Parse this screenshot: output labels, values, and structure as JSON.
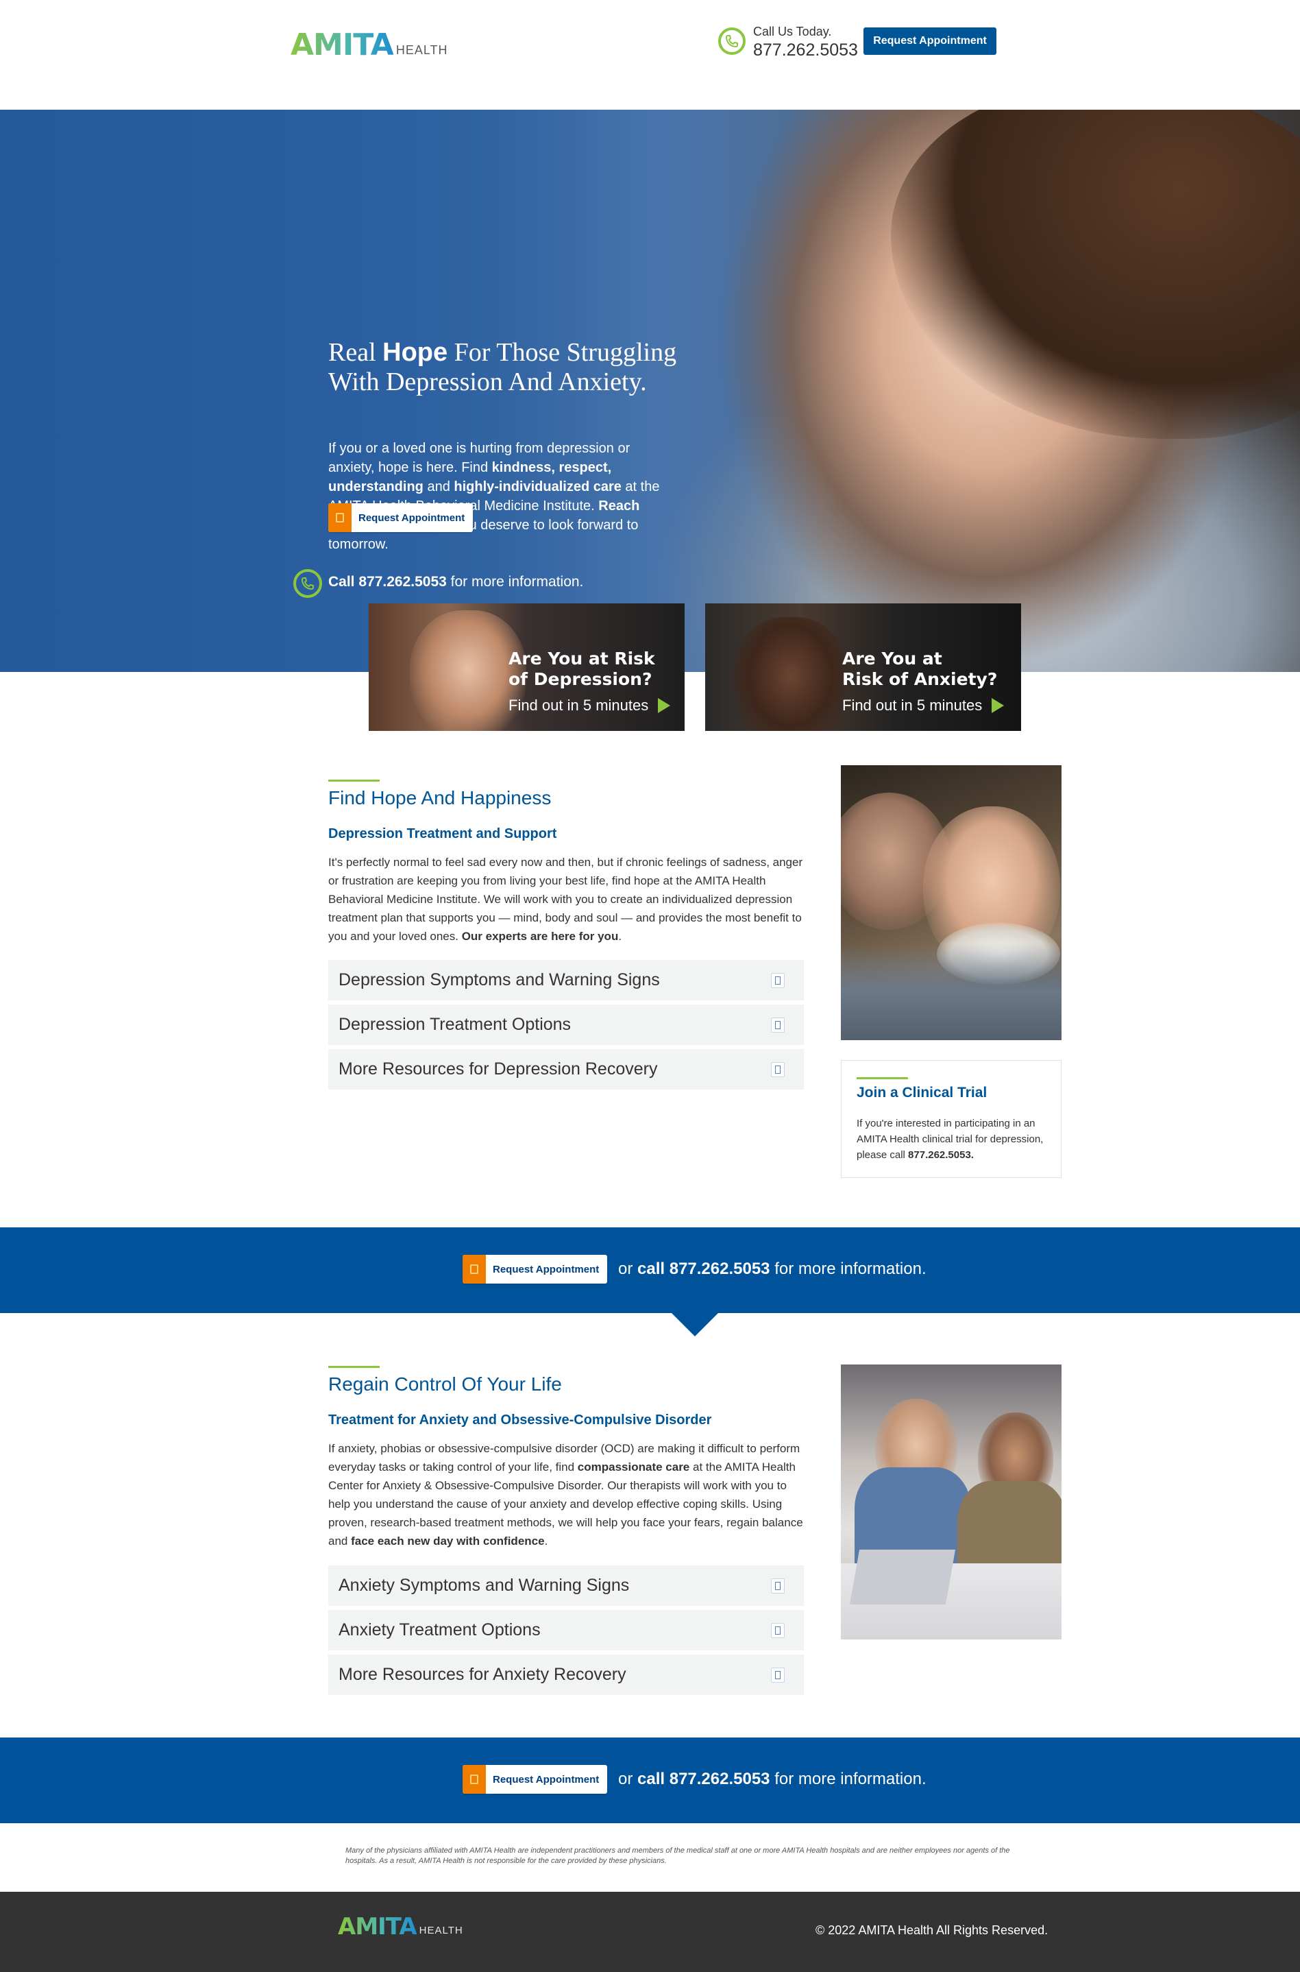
{
  "header": {
    "logo_main": "AMITA",
    "logo_sub": "HEALTH",
    "call_label": "Call Us Today.",
    "call_number": "877.262.5053",
    "request_button": "Request Appointment"
  },
  "hero": {
    "title_prefix": "Real ",
    "title_bold": "Hope",
    "title_suffix": " For Those Struggling With Depression And Anxiety.",
    "text_1": "If you or a loved one is hurting from depression or anxiety, hope is here. Find ",
    "text_bold_1": "kindness, respect, understanding",
    "text_2": " and ",
    "text_bold_2": "highly-individualized care",
    "text_3": " at the AMITA Health Behavioral Medicine Institute. ",
    "text_bold_3": "Reach out today",
    "text_4": ". Because you deserve to look forward to tomorrow.",
    "call_bold": "Call 877.262.5053",
    "call_suffix": " for more information.",
    "request_button": "Request Appointment"
  },
  "quiz": [
    {
      "title_line1": "Are You at Risk",
      "title_line2": "of Depression?",
      "cta": "Find out in 5 minutes"
    },
    {
      "title_line1": "Are You at",
      "title_line2": "Risk of Anxiety?",
      "cta": "Find out in 5 minutes"
    }
  ],
  "depression": {
    "title": "Find Hope And Happiness",
    "subtitle": "Depression Treatment and Support",
    "body_1": "It's perfectly normal to feel sad every now and then, but if chronic feelings of sadness, anger or frustration are keeping you from living your best life, find hope at the AMITA Health Behavioral Medicine Institute. We will work with you to create an individualized depression treatment plan that supports you — mind, body and soul — and provides the most benefit to you and your loved ones. ",
    "body_bold": "Our experts are here for you",
    "body_end": ".",
    "accordion": [
      "Depression Symptoms and Warning Signs",
      "Depression Treatment Options",
      "More Resources for Depression Recovery"
    ]
  },
  "trial": {
    "title": "Join a Clinical Trial",
    "text": "If you're interested in participating in an AMITA Health clinical trial for depression, please call ",
    "phone": "877.262.5053."
  },
  "cta_band": {
    "request_button": "Request Appointment",
    "or_call": "or ",
    "call_bold": "call 877.262.5053",
    "suffix": " for more information."
  },
  "anxiety": {
    "title": "Regain Control Of Your Life",
    "subtitle": "Treatment for Anxiety and Obsessive-Compulsive Disorder",
    "body_1": "If anxiety, phobias or obsessive-compulsive disorder (OCD) are making it difficult to perform everyday tasks or taking control of your life, find ",
    "body_bold_1": "compassionate care",
    "body_2": " at the AMITA Health Center for Anxiety & Obsessive-Compulsive Disorder. Our therapists will work with you to help you understand the cause of your anxiety and develop effective coping skills. Using proven, research-based treatment methods, we will help you face your fears, regain balance and ",
    "body_bold_2": "face each new day with confidence",
    "body_end": ".",
    "accordion": [
      "Anxiety Symptoms and Warning Signs",
      "Anxiety Treatment Options",
      "More Resources for Anxiety Recovery"
    ]
  },
  "disclaimer": "Many of the physicians affiliated with AMITA Health are independent practitioners and members of the medical staff at one or more AMITA Health hospitals and are neither employees nor agents of the hospitals. As a result, AMITA Health is not responsible for the care provided by these physicians.",
  "footer": {
    "logo_main": "AMITA",
    "logo_sub": "HEALTH",
    "copyright": "© 2022 AMITA Health All Rights Reserved."
  },
  "colors": {
    "brand_blue": "#005596",
    "band_blue": "#00529a",
    "accent_green": "#8cc63f",
    "accent_orange": "#f07d00",
    "footer_gray": "#333333"
  },
  "icons": [
    "phone-icon",
    "calendar-icon",
    "play-arrow-icon",
    "expand-icon"
  ]
}
